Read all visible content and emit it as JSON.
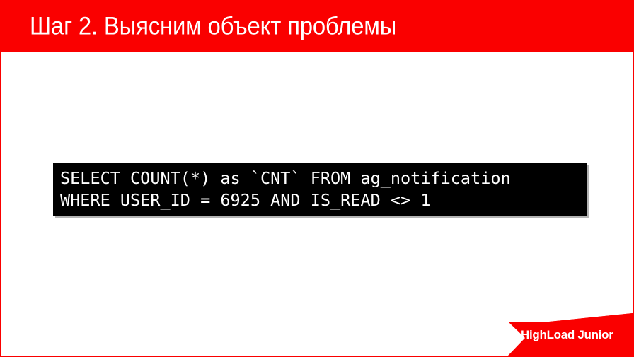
{
  "slide": {
    "header": {
      "title": "Шаг 2. Выясним объект проблемы",
      "background_color": "#FA0000",
      "text_color": "#FFFFFF"
    },
    "body": {
      "background_color": "#FFFFFF",
      "border_color": "#FA0000"
    },
    "code_block": {
      "background_color": "#000000",
      "text_color": "#FFFFFF",
      "shadow_color": "#B4B4B4",
      "language": "sql",
      "lines": [
        "SELECT COUNT(*) as `CNT` FROM ag_notification",
        "WHERE USER_ID = 6925 AND IS_READ <> 1"
      ]
    },
    "logo": {
      "text": "HighLoad Junior",
      "background_color": "#FA0000",
      "text_color": "#FFFFFF",
      "shape": "left-pointing-chevron-banner"
    }
  }
}
